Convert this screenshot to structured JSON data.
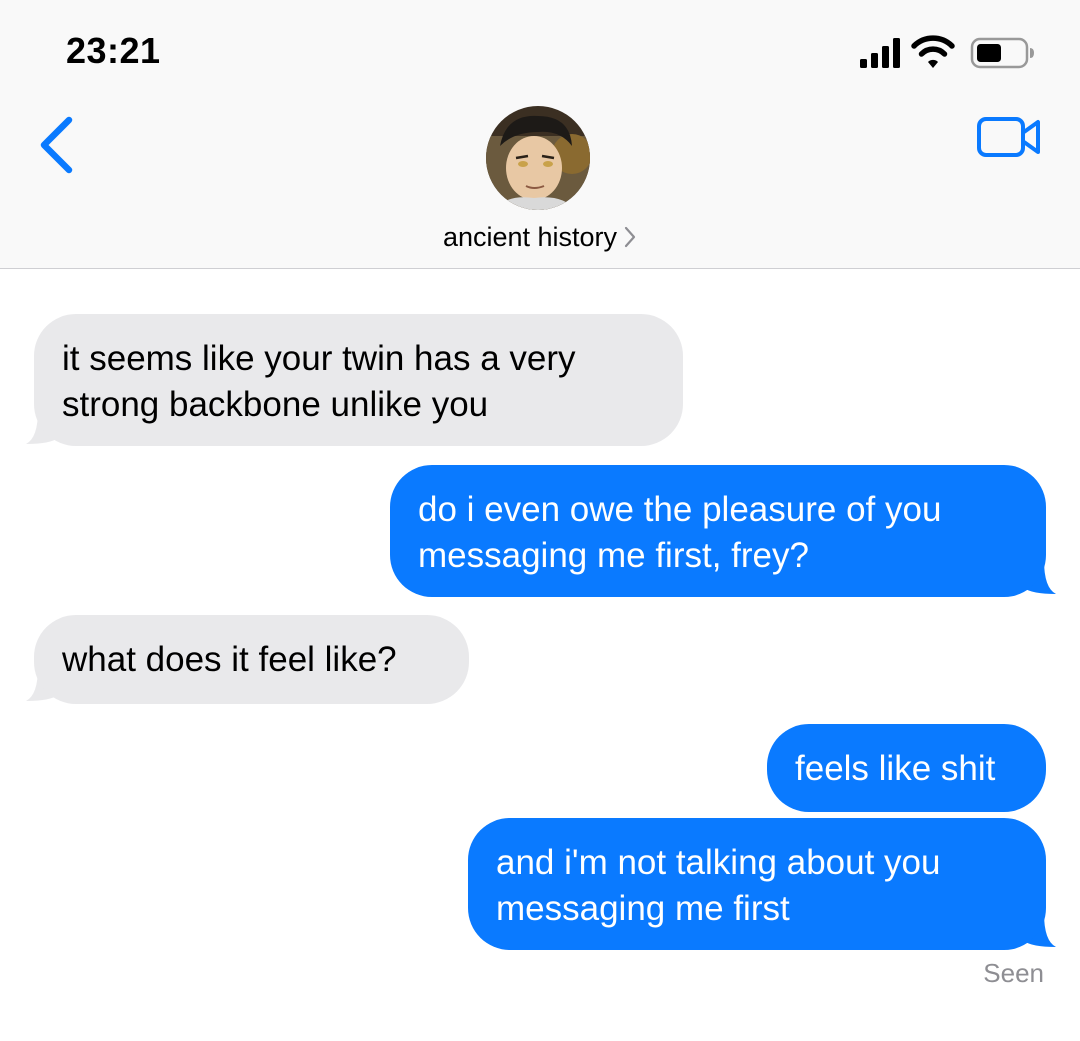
{
  "status_bar": {
    "time": "23:21",
    "icons": [
      "cellular-signal-icon",
      "wifi-icon",
      "battery-icon"
    ]
  },
  "nav": {
    "back_icon": "chevron-left-icon",
    "video_icon": "video-camera-icon",
    "contact_name": "ancient history",
    "contact_chevron": "chevron-right-icon",
    "avatar": "contact-avatar-photo"
  },
  "messages": [
    {
      "direction": "received",
      "lines": [
        "it seems like your twin has a very",
        "strong backbone unlike you"
      ]
    },
    {
      "direction": "sent",
      "lines": [
        "do i even owe the pleasure of you",
        "messaging me first, frey?"
      ]
    },
    {
      "direction": "received",
      "lines": [
        "what does it feel like?"
      ]
    },
    {
      "direction": "sent",
      "lines": [
        "feels like shit"
      ]
    },
    {
      "direction": "sent",
      "lines": [
        "and i'm not talking about you",
        "messaging me first"
      ]
    }
  ],
  "read_receipt": "Seen",
  "colors": {
    "accent": "#0a7aff",
    "received_bubble": "#e9e9eb",
    "sent_bubble": "#0a7aff",
    "header_bg": "#f9f9f9",
    "receipt_text": "#8e8e93"
  }
}
